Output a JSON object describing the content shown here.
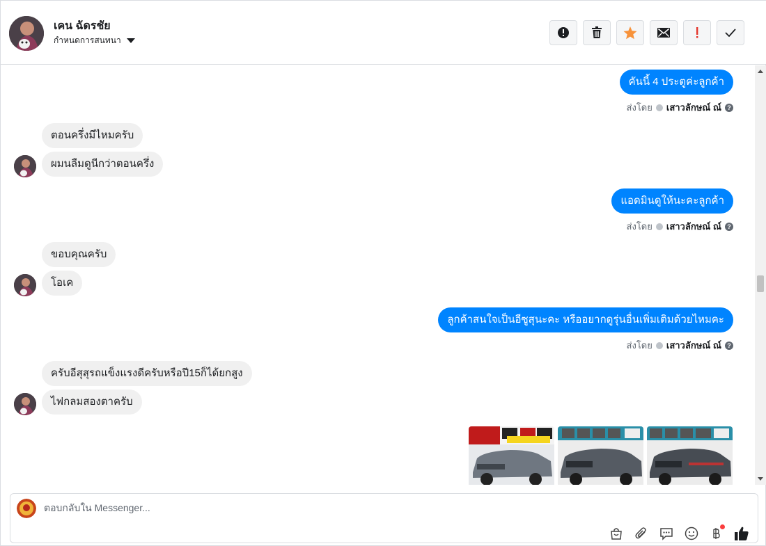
{
  "header": {
    "contact_name": "เคน ฉัดรชัย",
    "label_dropdown": "กำหนดการสนทนา"
  },
  "icons": {
    "spam": "exclamation-circle-icon",
    "delete": "trash-icon",
    "star": "star-icon",
    "unread": "envelope-icon",
    "important": "exclamation-icon",
    "done": "check-icon"
  },
  "colors": {
    "outgoing_bubble": "#0084ff",
    "incoming_bubble": "#f0f0f0",
    "star": "#f7923a",
    "important": "#e4352b"
  },
  "messages": {
    "out1": "คันนี้  4 ประตูค่ะลูกค้า",
    "in1a": "ตอนครึ่งมีไหมครับ",
    "in1b": "ผมนลืมดูนีกว่าตอนครึ่ง",
    "out2": "แอดมินดูให้นะคะลูกค้า",
    "in2a": "ขอบคุณครับ",
    "in2b": "โอเค",
    "out3": "ลูกค้าสนใจเป็นอีซูสุนะคะ หรืออยากดูรุ่นอื่นเพิ่มเติมด้วยไหมคะ",
    "in3a": "ครับอีสุสุรถแข็งแรงดีครับหรือปี15ก็ได้ยกสูง",
    "in3b": "ไฟกลมสองตาครับ"
  },
  "sent_by": {
    "prefix": "ส่งโดย",
    "author": "เสาวลักษณ์ ณ์"
  },
  "composer": {
    "placeholder": "ตอบกลับใน Messenger..."
  }
}
